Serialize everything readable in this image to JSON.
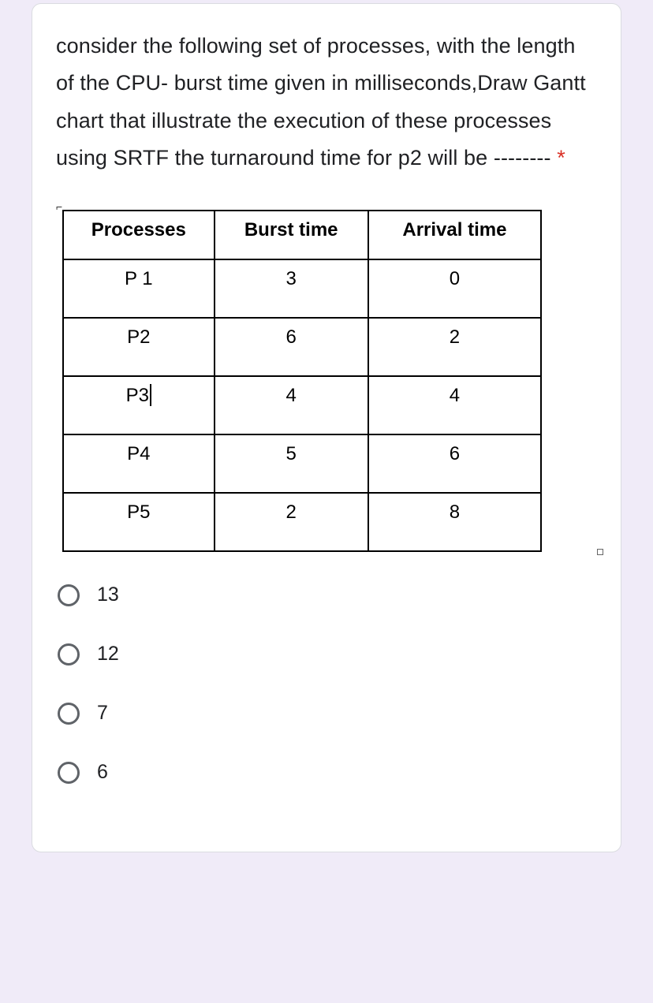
{
  "question": {
    "text": "consider the following set of processes, with the length of the CPU- burst time given in milliseconds,Draw Gantt chart that illustrate the execution of these processes using SRTF the turnaround time for p2 will be --------",
    "required_marker": "*"
  },
  "table": {
    "headers": [
      "Processes",
      "Burst time",
      "Arrival time"
    ],
    "rows": [
      {
        "process": "P 1",
        "burst": "3",
        "arrival": "0",
        "cursor": false
      },
      {
        "process": "P2",
        "burst": "6",
        "arrival": "2",
        "cursor": false
      },
      {
        "process": "P3",
        "burst": "4",
        "arrival": "4",
        "cursor": true
      },
      {
        "process": "P4",
        "burst": "5",
        "arrival": "6",
        "cursor": false
      },
      {
        "process": "P5",
        "burst": "2",
        "arrival": "8",
        "cursor": false
      }
    ]
  },
  "options": [
    "13",
    "12",
    "7",
    "6"
  ]
}
